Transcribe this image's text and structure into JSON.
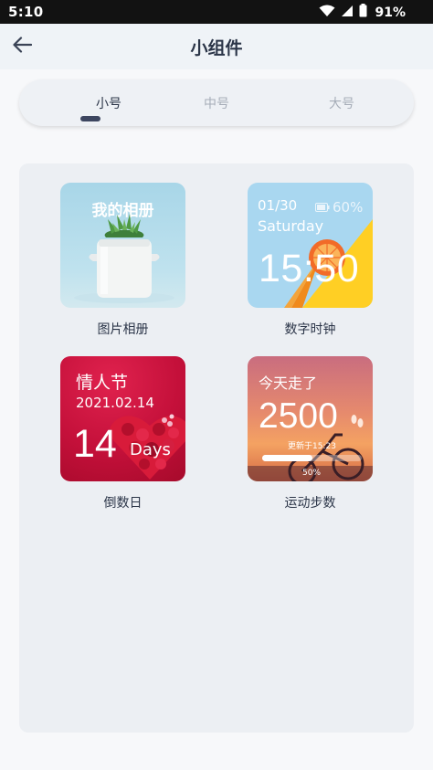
{
  "status_bar": {
    "time": "5:10",
    "battery": "91%"
  },
  "app_bar": {
    "title": "小组件"
  },
  "tabs": [
    {
      "label": "小号",
      "active": true
    },
    {
      "label": "中号",
      "active": false
    },
    {
      "label": "大号",
      "active": false
    }
  ],
  "widgets": {
    "album": {
      "label": "图片相册",
      "preview_title": "我的相册"
    },
    "clock": {
      "label": "数字时钟",
      "date": "01/30",
      "battery": "60%",
      "day": "Saturday",
      "time": "15:50"
    },
    "countdown": {
      "label": "倒数日",
      "event": "情人节",
      "date": "2021.02.14",
      "days": "14",
      "unit": "Days"
    },
    "steps": {
      "label": "运动步数",
      "title": "今天走了",
      "count": "2500",
      "updated": "更新于15:23",
      "progress_percent": "50%",
      "progress": 0.5
    }
  },
  "colors": {
    "accent": "#3d4660",
    "text_primary": "#2b3548",
    "text_inactive": "#a6adb8",
    "panel_bg": "#eceff3"
  }
}
